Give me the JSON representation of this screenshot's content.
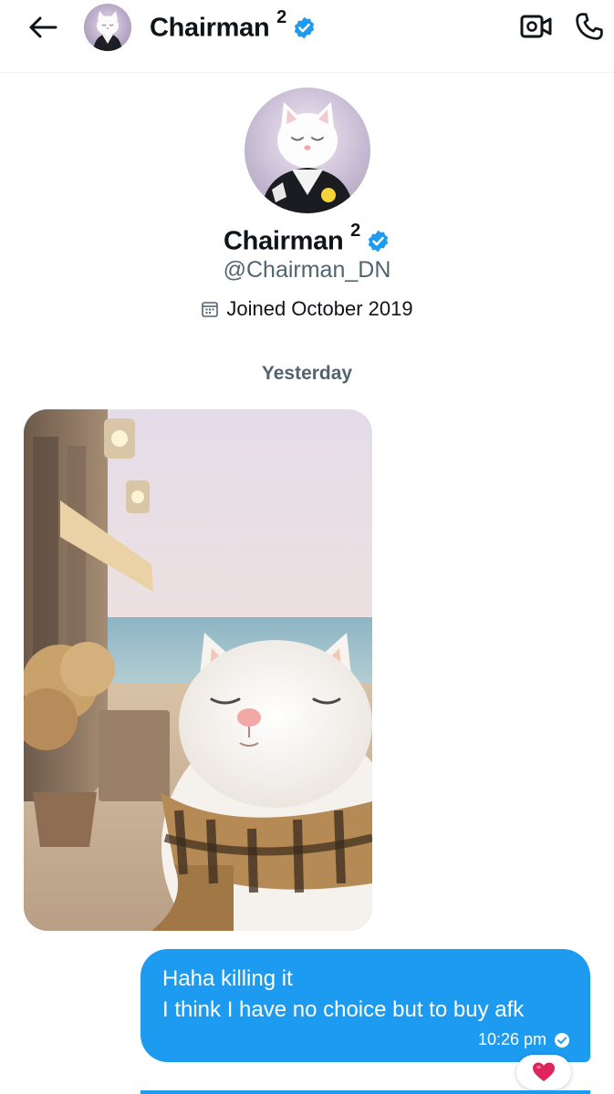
{
  "header": {
    "name": "Chairman",
    "superscript": "2",
    "icons": {
      "back": "arrow-left-icon",
      "video": "video-camera-icon",
      "call": "phone-icon",
      "verified": "verified-badge-icon"
    }
  },
  "profile": {
    "name": "Chairman",
    "superscript": "2",
    "handle": "@Chairman_DN",
    "joined": "Joined October 2019",
    "joined_icon": "calendar-icon"
  },
  "conversation": {
    "day_separator": "Yesterday",
    "messages": [
      {
        "type": "image",
        "description_icon": "photo-cat-with-scarf"
      },
      {
        "type": "text",
        "lines": [
          "Haha killing it",
          "I think I have no choice but to buy afk"
        ],
        "time": "10:26 pm",
        "status_icon": "read-check-icon",
        "reaction": "❤️"
      }
    ]
  },
  "colors": {
    "accent": "#1d9bf0",
    "text_primary": "#0f1419",
    "text_secondary": "#536471",
    "verified": "#1d9bf0"
  }
}
